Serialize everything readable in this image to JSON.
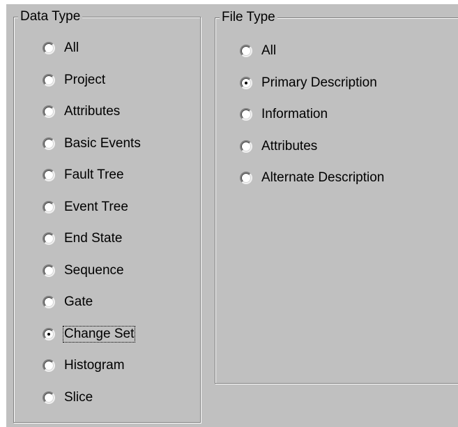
{
  "data_type": {
    "title": "Data Type",
    "selected": "Change Set",
    "options": [
      {
        "label": "All",
        "checked": false
      },
      {
        "label": "Project",
        "checked": false
      },
      {
        "label": "Attributes",
        "checked": false
      },
      {
        "label": "Basic Events",
        "checked": false
      },
      {
        "label": "Fault Tree",
        "checked": false
      },
      {
        "label": "Event Tree",
        "checked": false
      },
      {
        "label": "End State",
        "checked": false
      },
      {
        "label": "Sequence",
        "checked": false
      },
      {
        "label": "Gate",
        "checked": false
      },
      {
        "label": "Change Set",
        "checked": true,
        "focused": true
      },
      {
        "label": "Histogram",
        "checked": false
      },
      {
        "label": "Slice",
        "checked": false
      }
    ]
  },
  "file_type": {
    "title": "File Type",
    "selected": "Primary Description",
    "options": [
      {
        "label": "All",
        "checked": false
      },
      {
        "label": "Primary Description",
        "checked": true
      },
      {
        "label": "Information",
        "checked": false
      },
      {
        "label": "Attributes",
        "checked": false
      },
      {
        "label": "Alternate Description",
        "checked": false
      }
    ]
  }
}
